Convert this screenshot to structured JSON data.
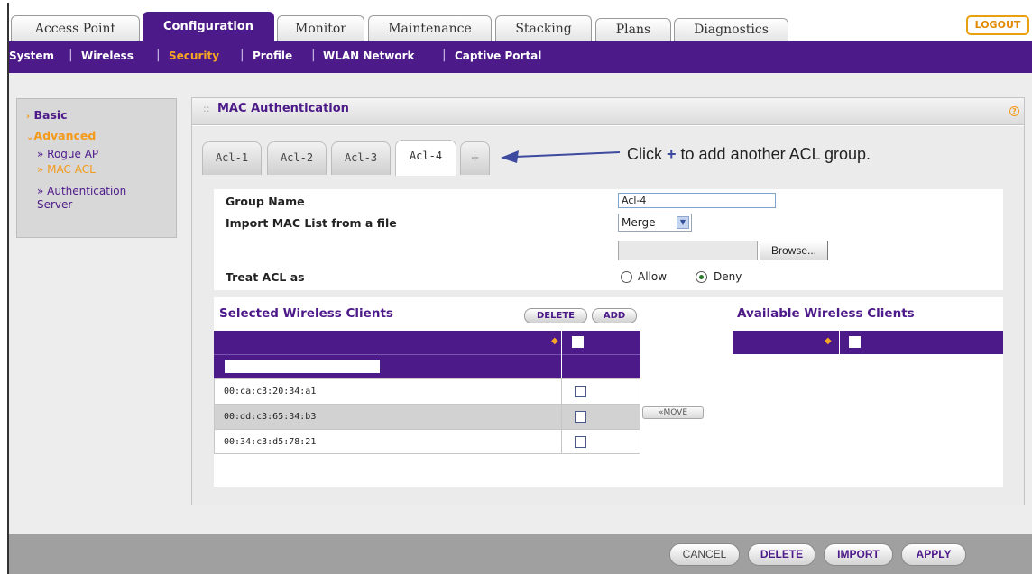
{
  "top_tabs": [
    {
      "label": "Access Point"
    },
    {
      "label": "Configuration"
    },
    {
      "label": "Monitor"
    },
    {
      "label": "Maintenance"
    },
    {
      "label": "Stacking"
    },
    {
      "label": "Plans"
    },
    {
      "label": "Diagnostics"
    }
  ],
  "logout_label": "LOGOUT",
  "subnav": [
    "System",
    "Wireless",
    "Security",
    "Profile",
    "WLAN Network",
    "Captive Portal"
  ],
  "sidebar": {
    "basic": "Basic",
    "advanced": "Advanced",
    "items": [
      "» Rogue AP",
      "» MAC ACL",
      "» Authentication Server"
    ]
  },
  "panel": {
    "title": "MAC Authentication",
    "help": "?"
  },
  "acl_tabs": [
    "Acl-1",
    "Acl-2",
    "Acl-3",
    "Acl-4",
    "+"
  ],
  "callout": {
    "prefix": "Click ",
    "plus": "+",
    "suffix": " to add another ACL group."
  },
  "form": {
    "group_name_label": "Group Name",
    "group_name_value": "Acl-4",
    "import_label": "Import MAC List from a file",
    "import_mode": "Merge",
    "browse_label": "Browse...",
    "treat_label": "Treat ACL as",
    "allow_label": "Allow",
    "deny_label": "Deny",
    "selected_option": "Deny"
  },
  "clients": {
    "selected_title": "Selected Wireless Clients",
    "available_title": "Available Wireless Clients",
    "delete_label": "DELETE",
    "add_label": "ADD",
    "move_label": "«MOVE",
    "rows": [
      "00:ca:c3:20:34:a1",
      "00:dd:c3:65:34:b3",
      "00:34:c3:d5:78:21"
    ]
  },
  "buttons": {
    "cancel": "CANCEL",
    "delete": "DELETE",
    "import": "IMPORT",
    "apply": "APPLY"
  },
  "colors": {
    "brand_purple": "#4d1a8a",
    "accent_orange": "#f39a1a"
  }
}
